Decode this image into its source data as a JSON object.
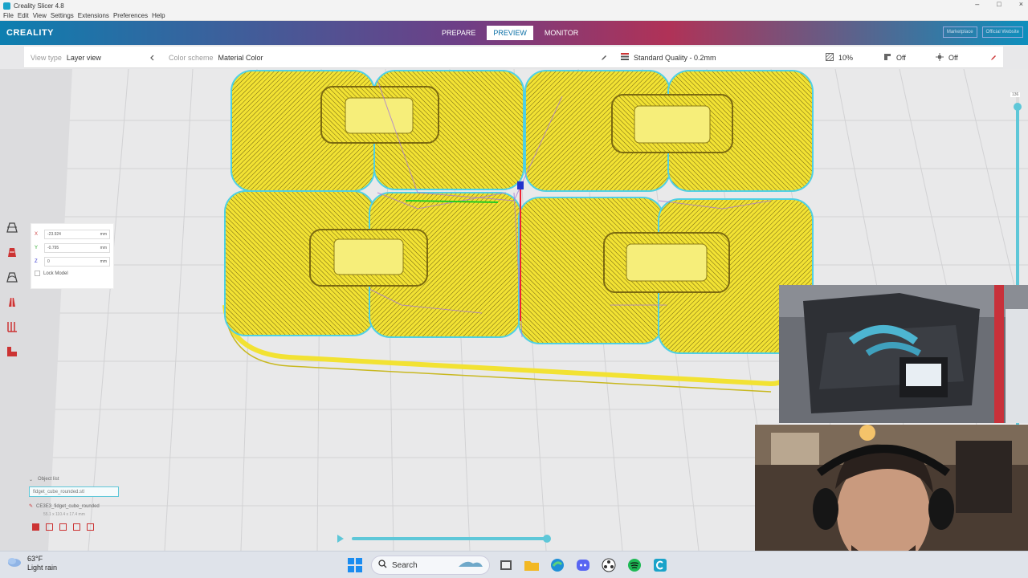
{
  "window": {
    "title": "Creality Slicer 4.8",
    "controls": [
      "–",
      "□",
      "×"
    ]
  },
  "menu": [
    "File",
    "Edit",
    "View",
    "Settings",
    "Extensions",
    "Preferences",
    "Help"
  ],
  "header": {
    "logo": "CREALITY",
    "stages": [
      {
        "label": "PREPARE",
        "active": false
      },
      {
        "label": "PREVIEW",
        "active": true
      },
      {
        "label": "MONITOR",
        "active": false
      }
    ],
    "buttons": [
      "Marketplace",
      "Official Website"
    ]
  },
  "toolbar": {
    "view_type_label": "View type",
    "view_type_value": "Layer view",
    "color_scheme_label": "Color scheme",
    "color_scheme_value": "Material Color",
    "profile": "Standard Quality - 0.2mm",
    "infill": "10%",
    "support": "Off",
    "adhesion": "Off"
  },
  "coords": {
    "x": {
      "axis": "X",
      "value": "-23.924",
      "unit": "mm"
    },
    "y": {
      "axis": "Y",
      "value": "-0.795",
      "unit": "mm"
    },
    "z": {
      "axis": "Z",
      "value": "0",
      "unit": "mm"
    },
    "lock_label": "Lock Model"
  },
  "layer_slider": {
    "top_value": "136",
    "level": 1.0
  },
  "object_list": {
    "header": "Object list",
    "file": "fidget_cube_rounded.stl",
    "model_name": "CE3E3_fidget_cube_rounded",
    "dimensions": "55.1 x 110.4 x 17.4 mm"
  },
  "playback": {
    "progress": 1.0
  },
  "taskbar": {
    "temperature": "63°F",
    "weather": "Light rain",
    "search_placeholder": "Search"
  },
  "colors": {
    "accent": "#5ec7d8",
    "print_yellow": "#f2e233",
    "brand_blue": "#0d7fb0"
  }
}
